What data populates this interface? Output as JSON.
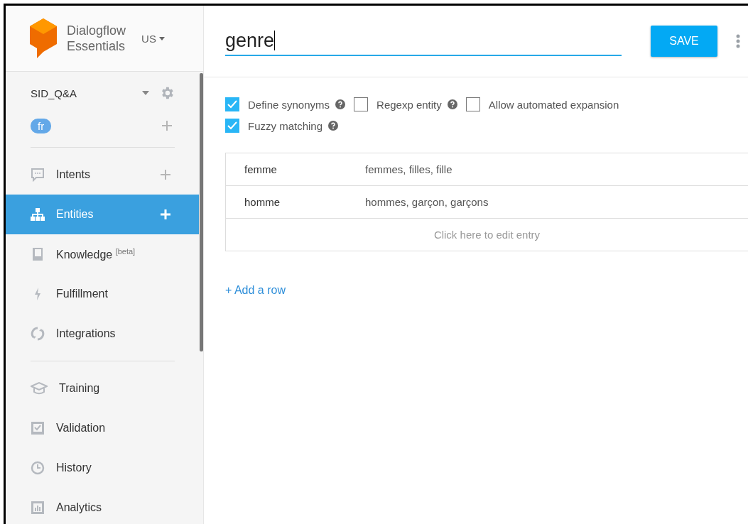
{
  "brand": {
    "line1": "Dialogflow",
    "line2": "Essentials",
    "region": "US"
  },
  "project": {
    "name": "SID_Q&A",
    "language": "fr"
  },
  "nav_primary": [
    {
      "label": "Intents",
      "selected": false,
      "add": true
    },
    {
      "label": "Entities",
      "selected": true,
      "add": true
    },
    {
      "label": "Knowledge $^{[beta]}$",
      "selected": false,
      "add": false
    },
    {
      "label": "Fulfillment",
      "selected": false,
      "add": false
    },
    {
      "label": "Integrations",
      "selected": false,
      "add": false
    }
  ],
  "nav_secondary": [
    {
      "label": "Training",
      "selected": false
    },
    {
      "label": "Validation",
      "selected": false
    },
    {
      "label": "History",
      "selected": false
    },
    {
      "label": "Analytics",
      "selected": false
    }
  ],
  "entity_name": {
    "value": "genre"
  },
  "save_button": "SAVE",
  "options": [
    {
      "label": "Define synonyms",
      "checked": true,
      "help": true
    },
    {
      "label": "Regexp entity",
      "checked": false,
      "help": true
    },
    {
      "label": "Allow automated expansion",
      "checked": false,
      "help": false
    },
    {
      "label": "Fuzzy matching",
      "checked": true,
      "help": true
    }
  ],
  "entries": [
    {
      "value": "femme",
      "synonyms": "femmes, filles, fille"
    },
    {
      "value": "homme",
      "synonyms": "hommes, garçon, garçons"
    }
  ],
  "edit_entry_placeholder": "Click here to edit entry",
  "add_row": "+ Add a row"
}
